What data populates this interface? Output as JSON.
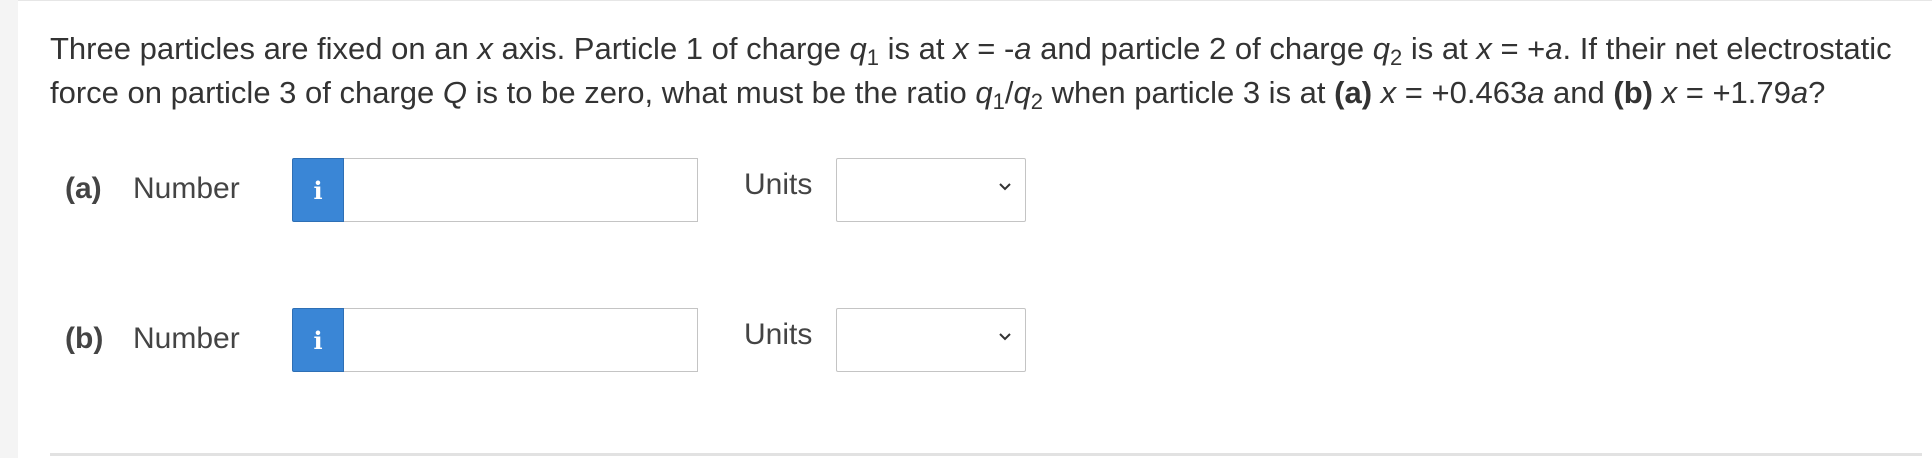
{
  "question": {
    "s1": "Three particles are fixed on an ",
    "x": "x",
    "s2": " axis. Particle 1 of charge ",
    "q": "q",
    "sub1": "1",
    "s3": " is at ",
    "s4": " = -",
    "a": "a",
    "s5": " and particle 2 of charge ",
    "sub2": "2",
    "s6": " is at ",
    "s7": " = +",
    "s8": ". If their net electrostatic force on particle 3 of charge ",
    "Q": "Q",
    "s9": " is to be zero, what must be the ratio ",
    "slash": "/",
    "s10": " when particle 3 is at ",
    "partA": "(a)",
    "s11": " = +0.463",
    "s12": " and ",
    "partB": "(b)",
    "s13": " = +1.79",
    "s14": "?"
  },
  "parts": [
    {
      "label": "(a)",
      "number_label": "Number",
      "info_icon": "i",
      "number_value": "",
      "units_label": "Units",
      "units_selected": ""
    },
    {
      "label": "(b)",
      "number_label": "Number",
      "info_icon": "i",
      "number_value": "",
      "units_label": "Units",
      "units_selected": ""
    }
  ],
  "colors": {
    "info_button": "#3a86d6",
    "text": "#333333",
    "border": "#c4c4c4"
  }
}
